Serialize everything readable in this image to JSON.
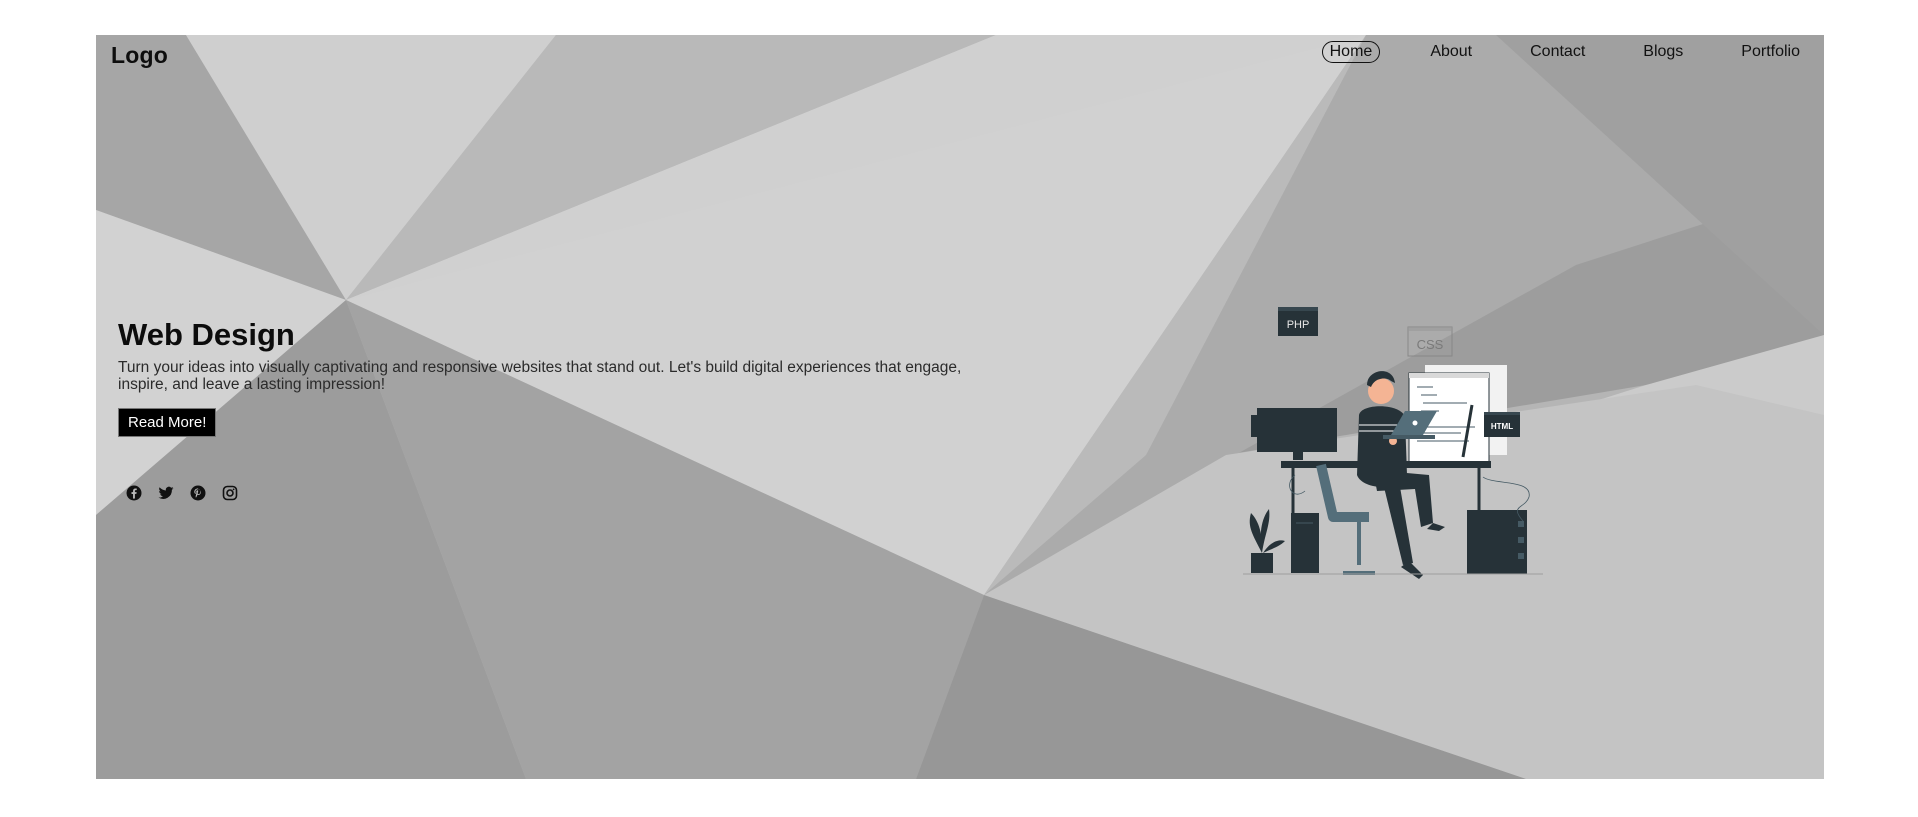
{
  "header": {
    "logo": "Logo",
    "nav": [
      {
        "label": "Home",
        "active": true
      },
      {
        "label": "About",
        "active": false
      },
      {
        "label": "Contact",
        "active": false
      },
      {
        "label": "Blogs",
        "active": false
      },
      {
        "label": "Portfolio",
        "active": false
      }
    ]
  },
  "hero": {
    "title": "Web Design",
    "description": "Turn your ideas into visually captivating and responsive websites that stand out. Let's build digital experiences that engage, inspire, and leave a lasting impression!",
    "cta_label": "Read More!"
  },
  "socials": [
    {
      "icon": "facebook-icon"
    },
    {
      "icon": "twitter-icon"
    },
    {
      "icon": "pinterest-icon"
    },
    {
      "icon": "instagram-icon"
    }
  ],
  "illustration": {
    "tags": {
      "php": "PHP",
      "css": "CSS",
      "html": "HTML"
    }
  },
  "colors": {
    "page_background": "#ffffff",
    "hero_background": "#b4b4b4",
    "text_dark": "#0c0c0c",
    "button_background": "#000000",
    "button_text": "#ffffff",
    "illustration_dark": "#263238"
  }
}
